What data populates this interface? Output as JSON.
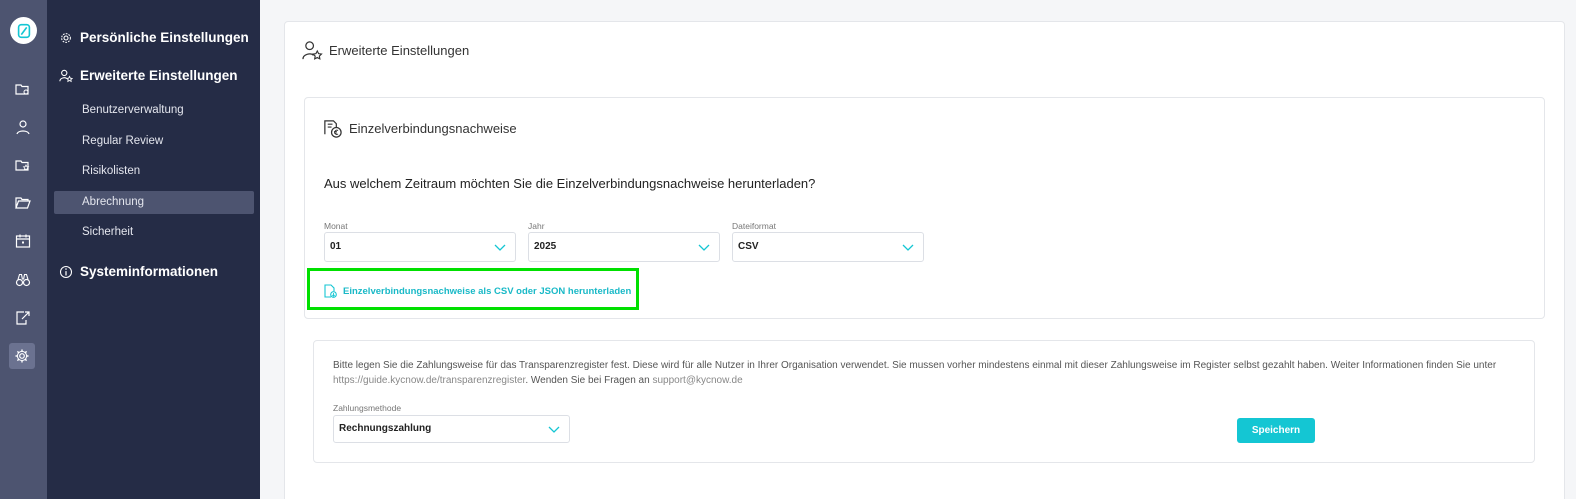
{
  "nav": {
    "sections": [
      {
        "label": "Persönliche Einstellungen"
      },
      {
        "label": "Erweiterte Einstellungen"
      },
      {
        "label": "Systeminformationen"
      }
    ],
    "sub_items": [
      {
        "label": "Benutzerverwaltung"
      },
      {
        "label": "Regular Review"
      },
      {
        "label": "Risikolisten"
      },
      {
        "label": "Abrechnung",
        "active": true
      },
      {
        "label": "Sicherheit"
      }
    ]
  },
  "main": {
    "title": "Erweiterte Einstellungen",
    "card": {
      "title": "Einzelverbindungsnachweise",
      "question": "Aus welchem Zeitraum möchten Sie die Einzelverbindungsnachweise herunterladen?",
      "fields": [
        {
          "label": "Monat",
          "value": "01"
        },
        {
          "label": "Jahr",
          "value": "2025"
        },
        {
          "label": "Dateiformat",
          "value": "CSV"
        }
      ],
      "download_link": "Einzelverbindungsnachweise als CSV oder JSON herunterladen"
    },
    "payment": {
      "info_text_1": "Bitte legen Sie die Zahlungsweise für das Transparenzregister fest. Diese wird für alle Nutzer in Ihrer Organisation verwendet. Sie mussen vorher mindestens einmal mit dieser Zahlungsweise im Register selbst gezahlt haben. Weiter Informationen finden Sie unter",
      "info_link_1": "https://guide.kycnow.de/transparenzregister",
      "info_text_2": ". Wenden Sie bei Fragen an",
      "info_link_2": "support@kycnow.de",
      "label": "Zahlungsmethode",
      "value": "Rechnungszahlung",
      "save_label": "Speichern"
    }
  },
  "colors": {
    "accent": "#14c6d3",
    "nav_bg": "#252c46",
    "rail_bg": "#4d5470",
    "highlight": "#00e000"
  }
}
